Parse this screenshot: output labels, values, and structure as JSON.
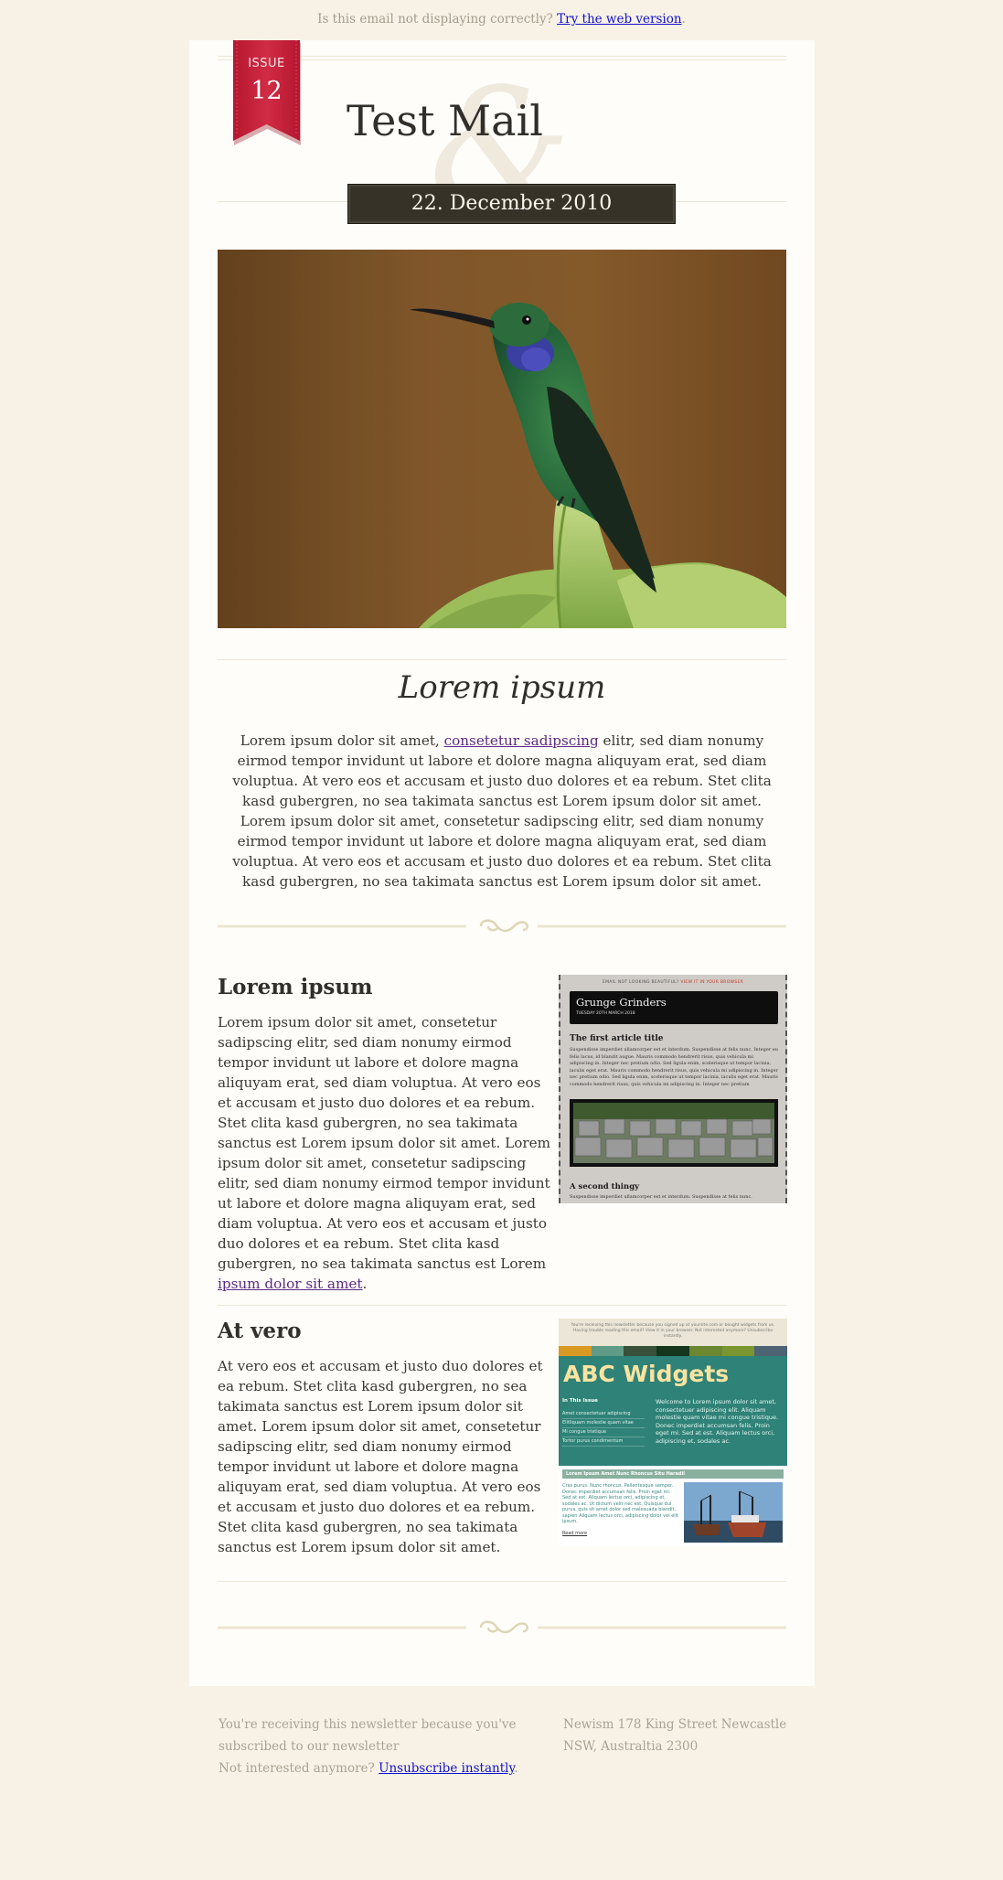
{
  "preheader": {
    "text": "Is this email not displaying correctly?",
    "link": "Try the web version",
    "end": "."
  },
  "header": {
    "issue_label": "ISSUE",
    "issue_number": "12",
    "ampersand": "&",
    "title": "Test Mail",
    "date": "22. December 2010"
  },
  "intro": {
    "heading": "Lorem ipsum",
    "before": "Lorem ipsum dolor sit amet, ",
    "link": "consetetur sadipscing",
    "after": " elitr, sed diam nonumy eirmod tempor invidunt ut labore et dolore magna aliquyam erat, sed diam voluptua. At vero eos et accusam et justo duo dolores et ea rebum. Stet clita kasd gubergren, no sea takimata sanctus est Lorem ipsum dolor sit amet. Lorem ipsum dolor sit amet, consetetur sadipscing elitr, sed diam nonumy eirmod tempor invidunt ut labore et dolore magna aliquyam erat, sed diam voluptua. At vero eos et accusam et justo duo dolores et ea rebum. Stet clita kasd gubergren, no sea takimata sanctus est Lorem ipsum dolor sit amet."
  },
  "article1": {
    "heading": "Lorem ipsum",
    "text": "Lorem ipsum dolor sit amet, consetetur sadipscing elitr, sed diam nonumy eirmod tempor invidunt ut labore et dolore magna aliquyam erat, sed diam voluptua. At vero eos et accusam et justo duo dolores et ea rebum. Stet clita kasd gubergren, no sea takimata sanctus est Lorem ipsum dolor sit amet. Lorem ipsum dolor sit amet, consetetur sadipscing elitr, sed diam nonumy eirmod tempor invidunt ut labore et dolore magna aliquyam erat, sed diam voluptua. At vero eos et accusam et justo duo dolores et ea rebum. Stet clita kasd gubergren, no sea takimata sanctus est Lorem",
    "link": " ipsum dolor sit amet",
    "end": "."
  },
  "thumb1": {
    "topline": "EMAIL NOT LOOKING BEAUTIFUL?",
    "topline_link": "VIEW IT IN YOUR BROWSER",
    "brand": "Grunge Grinders",
    "date": "TUESDAY 20TH MARCH 2018",
    "h1": "The first article title",
    "p1": "Suspendisse imperdiet ullamcorper est et interdum. Suspendisse at felis nunc. Integer eu felis lacus, id blandit augue. Mauris commodo hendrerit risus, quis vehicula mi adipiscing in. Integer nec pretium odio. Sed ligula enim, scelerisque ut tempor lacinia, iaculis eget erat. Mauris commodo hendrerit risus, quis vehicula mi adipiscing in. Integer nec pretium odio. Sed ligula enim, scelerisque ut tempor lacinia, iaculis eget erat. Mauris commodo hendrerit risus, quis vehicula mi adipiscing in. Integer nec pretium",
    "h2": "A second thingy",
    "p2": "Suspendisse imperdiet ullamcorper est et interdum. Suspendisse at felis nunc."
  },
  "article2": {
    "heading": "At vero",
    "text": "At vero eos et accusam et justo duo dolores et ea rebum. Stet clita kasd gubergren, no sea takimata sanctus est Lorem ipsum dolor sit amet. Lorem ipsum dolor sit amet, consetetur sadipscing elitr, sed diam nonumy eirmod tempor invidunt ut labore et dolore magna aliquyam erat, sed diam voluptua. At vero eos et accusam et justo duo dolores et ea rebum. Stet clita kasd gubergren, no sea takimata sanctus est Lorem ipsum dolor sit amet."
  },
  "thumb2": {
    "topline": "You're receiving this newsletter because you signed up at yoursite.com or bought widgets from us. Having trouble reading this email? View it in your browser. Not interested anymore? Unsubscribe instantly.",
    "brand": "ABC Widgets",
    "issue_label": "In This Issue",
    "issue_items": [
      "Amet consectetuer adipiscing",
      "Elitliquam molestie quam vitae",
      "Mi congue tristique",
      "Tortor purus condimentum"
    ],
    "welcome": "Welcome to Lorem ipsum dolor sit amet, consectetuer adipiscing elit. Aliquam molestie quam vitae mi congue tristique. Donec imperdiet accumsan felis. Proin eget mi. Sed at est. Aliquam lectus orci, adipiscing et, sodales ac.",
    "band": "Lorem Ipsum Amet Nunc Rhoncus Situ Haradil",
    "body": "Cras purus. Nunc rhoncus. Pellentesque semper. Donec imperdiet accumsan felis. Proin eget mi. Sed at est. Aliquam lectus orci, adipiscing et, sodales ac. Ut dictum velit nec est. Quisque dui purus, quis sit amet dolor sed malesuada blandit, sapien Aliquam lectus orci, adipiscing dolor vel elit ipsum.",
    "read_more": "Read more",
    "colors": [
      "#d99a23",
      "#5f9b86",
      "#39503b",
      "#15351d",
      "#6b8730",
      "#7b9630",
      "#4e6374"
    ]
  },
  "footer": {
    "left1": "You're receiving this newsletter because you've",
    "left2": "subscribed to our newsletter",
    "left3": "Not interested anymore?",
    "unsubscribe": "Unsubscribe instantly",
    "end": ".",
    "right1": "Newism 178 King Street Newcastle",
    "right2": "NSW, Australtia 2300"
  },
  "colors": {
    "background": "#f8f2e6",
    "card": "#fffdf9",
    "ribbon": "#c8243c",
    "date_box": "#373228",
    "link": "#1111cc",
    "visited_link": "#5b2a86"
  }
}
